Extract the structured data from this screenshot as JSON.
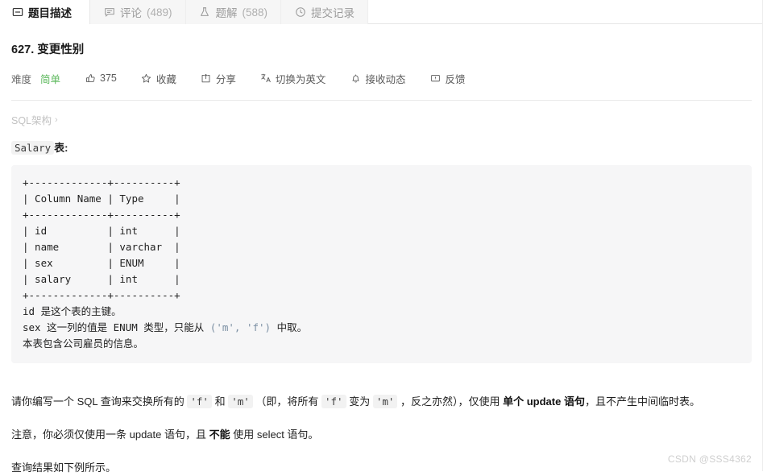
{
  "tabs": [
    {
      "label": "题目描述",
      "count": "",
      "icon": "description-icon",
      "active": true
    },
    {
      "label": "评论",
      "count": "(489)",
      "icon": "comment-icon",
      "active": false
    },
    {
      "label": "题解",
      "count": "(588)",
      "icon": "flask-icon",
      "active": false
    },
    {
      "label": "提交记录",
      "count": "",
      "icon": "clock-icon",
      "active": false
    }
  ],
  "problem": {
    "title": "627. 变更性别",
    "difficulty_label": "难度",
    "difficulty_value": "简单",
    "difficulty_color": "#5cb85c"
  },
  "actions": [
    {
      "label": "375",
      "icon": "thumbs-up-icon"
    },
    {
      "label": "收藏",
      "icon": "star-icon"
    },
    {
      "label": "分享",
      "icon": "share-icon"
    },
    {
      "label": "切换为英文",
      "icon": "translate-icon"
    },
    {
      "label": "接收动态",
      "icon": "bell-icon"
    },
    {
      "label": "反馈",
      "icon": "feedback-icon"
    }
  ],
  "schema": {
    "label": "SQL架构",
    "chevron": "›"
  },
  "table_intro": {
    "code": "Salary",
    "suffix": "表:"
  },
  "code_block": {
    "ascii_table": "+-------------+----------+\n| Column Name | Type     |\n+-------------+----------+\n| id          | int      |\n| name        | varchar  |\n| sex         | ENUM     |\n| salary      | int      |\n+-------------+----------+",
    "note_1": "id 是这个表的主键。",
    "note_2_pre": "sex 这一列的值是 ENUM 类型，只能从 ",
    "note_2_str": "('m', 'f')",
    "note_2_post": " 中取。",
    "note_3": "本表包含公司雇员的信息。"
  },
  "paragraphs": {
    "p1_a": "请你编写一个 SQL 查询来交换所有的 ",
    "p1_code1": "'f'",
    "p1_b": " 和 ",
    "p1_code2": "'m'",
    "p1_c": " （即，将所有 ",
    "p1_code3": "'f'",
    "p1_d": " 变为 ",
    "p1_code4": "'m'",
    "p1_e": " ，反之亦然），仅使用 ",
    "p1_bold": "单个 update 语句",
    "p1_f": "，且不产生中间临时表。",
    "p2_a": "注意，你必须仅使用一条 update 语句，且 ",
    "p2_bold": "不能",
    "p2_b": " 使用 select 语句。",
    "p3": "查询结果如下例所示。"
  },
  "watermark": "CSDN @SSS4362"
}
